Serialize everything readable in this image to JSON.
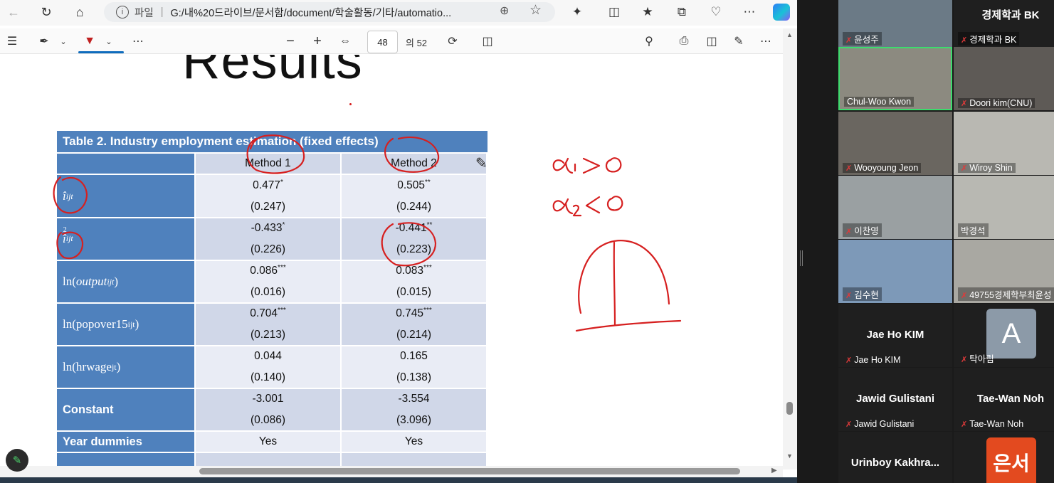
{
  "browser": {
    "addr_scheme": "파일",
    "addr_url": "G:/내%20드라이브/문서함/document/학술활동/기타/automatio...",
    "page_current": "48",
    "page_total": "의 52"
  },
  "slide": {
    "title": "Results"
  },
  "table": {
    "caption": "Table 2. Industry employment estimation (fixed effects)",
    "columns": [
      "Method 1",
      "Method 2"
    ],
    "rows": [
      {
        "m1": "0.477",
        "m1_sig": "*",
        "m1_se": "(0.247)",
        "m2": "0.505",
        "m2_sig": "**",
        "m2_se": "(0.244)"
      },
      {
        "m1": "-0.433",
        "m1_sig": "*",
        "m1_se": "(0.226)",
        "m2": "-0.441",
        "m2_sig": "**",
        "m2_se": "(0.223)"
      },
      {
        "label_fn": "ln",
        "label_var": "output",
        "label_sub": "ijt",
        "m1": "0.086",
        "m1_sig": "***",
        "m1_se": "(0.016)",
        "m2": "0.083",
        "m2_sig": "***",
        "m2_se": "(0.015)"
      },
      {
        "label_fn": "ln",
        "label_var": "popover15",
        "label_sub": "ijt",
        "m1": "0.704",
        "m1_sig": "***",
        "m1_se": "(0.213)",
        "m2": "0.745",
        "m2_sig": "***",
        "m2_se": "(0.214)"
      },
      {
        "label_fn": "ln",
        "label_var": "hrwage",
        "label_sub": "jt",
        "m1": "0.044",
        "m1_se": "(0.140)",
        "m2": "0.165",
        "m2_se": "(0.138)"
      },
      {
        "label": "Constant",
        "m1": "-3.001",
        "m1_se": "(0.086)",
        "m2": "-3.554",
        "m2_se": "(3.096)"
      },
      {
        "label": "Year dummies",
        "m1": "Yes",
        "m2": "Yes"
      }
    ]
  },
  "participants": [
    {
      "name": "윤성주",
      "muted": true
    },
    {
      "name": "경제학과 BK",
      "muted": true,
      "title": "경제학과 BK"
    },
    {
      "name": "Chul-Woo Kwon",
      "muted": false,
      "active": true
    },
    {
      "name": "Doori kim(CNU)",
      "muted": true
    },
    {
      "name": "Wooyoung Jeon",
      "muted": true
    },
    {
      "name": "Wiroy Shin",
      "muted": true
    },
    {
      "name": "이찬영",
      "muted": true
    },
    {
      "name": "박경석",
      "muted": false
    },
    {
      "name": "김수현",
      "muted": true
    },
    {
      "name": "49755경제학부최윤성",
      "muted": true
    },
    {
      "name": "Jae Ho KIM",
      "muted": true,
      "title": "Jae Ho KIM"
    },
    {
      "name": "탁아림",
      "muted": true,
      "avatar_letter": "A"
    },
    {
      "name": "Jawid Gulistani",
      "muted": true,
      "title": "Jawid Gulistani"
    },
    {
      "name": "Tae-Wan Noh",
      "muted": true,
      "title": "Tae-Wan Noh"
    },
    {
      "title": "Urinboy  Kakhra..."
    },
    {
      "avatar_text": "은서"
    }
  ],
  "colors": {
    "table_header": "#4f81bd",
    "row_light": "#e9ecf5",
    "row_dark": "#d0d7e8",
    "ink": "#d62020",
    "active_speaker": "#3ddc6d"
  }
}
